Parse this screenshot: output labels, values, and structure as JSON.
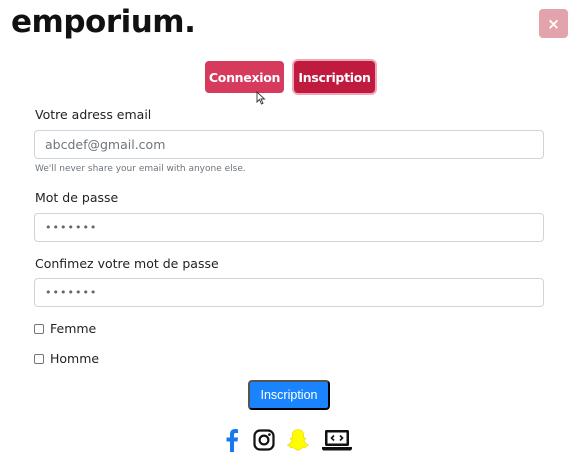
{
  "brand": {
    "logo": "emporium."
  },
  "header": {
    "close_label": "×"
  },
  "tabs": {
    "login": "Connexion",
    "signup": "Inscription"
  },
  "form": {
    "email_label": "Votre adress email",
    "email_placeholder": "abcdef@gmail.com",
    "email_help": "We'll never share your email with anyone else.",
    "password_label": "Mot de passe",
    "password_value": "•••••••",
    "confirm_label": "Confimez votre mot de passe",
    "confirm_value": "•••••••",
    "gender_female": "Femme",
    "gender_male": "Homme",
    "submit_label": "Inscription"
  },
  "social": {
    "icons": [
      "facebook-icon",
      "instagram-icon",
      "snapchat-icon",
      "laptop-code-icon"
    ],
    "colors": {
      "facebook": "#1877f2",
      "snapchat": "#fffc00",
      "instagram": "#111111",
      "laptop": "#111111"
    }
  },
  "colors": {
    "primary": "#1a84ff",
    "danger": "#d63a5c",
    "danger_dark": "#c01a3f",
    "close": "#e2a3ad"
  }
}
